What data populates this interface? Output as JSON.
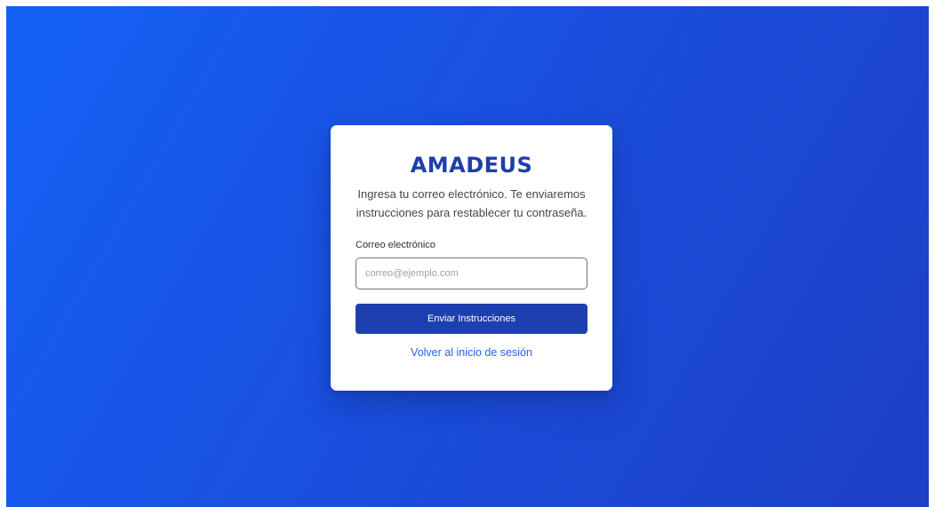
{
  "colors": {
    "background_start": "#1461f5",
    "background_end": "#1d3fc4",
    "brand": "#1e3fa8",
    "button": "#1e3fb0",
    "link": "#2563eb"
  },
  "card": {
    "logo": "AMADEUS",
    "description": "Ingresa tu correo electrónico. Te enviaremos instrucciones para restablecer tu contraseña.",
    "email_label": "Correo electrónico",
    "email_value": "",
    "email_placeholder": "correo@ejemplo.com",
    "submit_label": "Enviar Instrucciones",
    "back_link": "Volver al inicio de sesión"
  }
}
